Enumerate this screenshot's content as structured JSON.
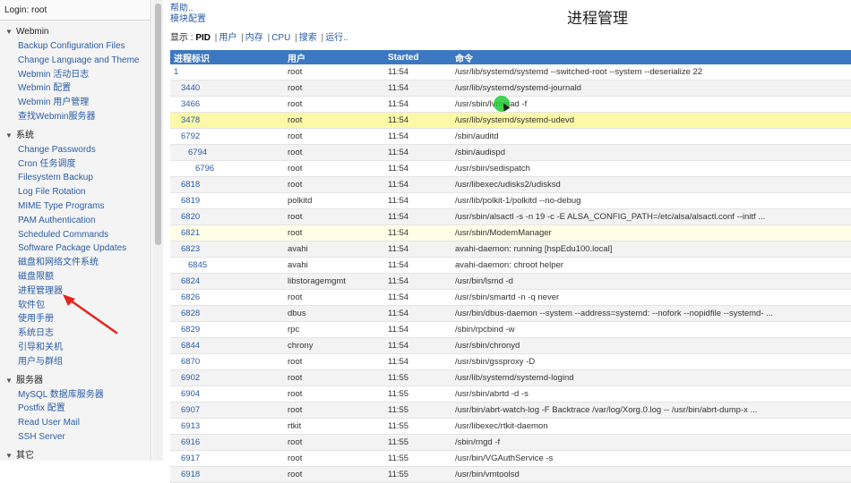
{
  "login": "Login: root",
  "sidebar": {
    "categories": [
      {
        "label": "Webmin",
        "items": [
          "Backup Configuration Files",
          "Change Language and Theme",
          "Webmin 活动日志",
          "Webmin 配置",
          "Webmin 用户管理",
          "查找Webmin服务器"
        ]
      },
      {
        "label": "系统",
        "items": [
          "Change Passwords",
          "Cron 任务调度",
          "Filesystem Backup",
          "Log File Rotation",
          "MIME Type Programs",
          "PAM Authentication",
          "Scheduled Commands",
          "Software Package Updates",
          "磁盘和网络文件系统",
          "磁盘限额",
          "进程管理器",
          "软件包",
          "使用手册",
          "系统日志",
          "引导和关机",
          "用户与群组"
        ]
      },
      {
        "label": "服务器",
        "items": [
          "MySQL 数据库服务器",
          "Postfix 配置",
          "Read User Mail",
          "SSH Server"
        ]
      },
      {
        "label": "其它",
        "items": []
      }
    ]
  },
  "top_links": [
    "帮助..",
    "模块配置"
  ],
  "title": "进程管理",
  "display_bar": {
    "prefix": "显示 :",
    "active": "PID",
    "links": [
      "用户",
      "内存",
      "CPU",
      "搜索",
      "运行.."
    ]
  },
  "table": {
    "headers": [
      "进程标识",
      "用户",
      "Started",
      "命令"
    ],
    "rows": [
      {
        "pid": "1",
        "indent": 0,
        "user": "root",
        "started": "11:54",
        "cmd": "/usr/lib/systemd/systemd --switched-root --system --deserialize 22"
      },
      {
        "pid": "3440",
        "indent": 1,
        "user": "root",
        "started": "11:54",
        "cmd": "/usr/lib/systemd/systemd-journald"
      },
      {
        "pid": "3466",
        "indent": 1,
        "user": "root",
        "started": "11:54",
        "cmd": "/usr/sbin/lvmetad -f"
      },
      {
        "pid": "3478",
        "indent": 1,
        "user": "root",
        "started": "11:54",
        "cmd": "/usr/lib/systemd/systemd-udevd"
      },
      {
        "pid": "6792",
        "indent": 1,
        "user": "root",
        "started": "11:54",
        "cmd": "/sbin/auditd"
      },
      {
        "pid": "6794",
        "indent": 2,
        "user": "root",
        "started": "11:54",
        "cmd": "/sbin/audispd"
      },
      {
        "pid": "6796",
        "indent": 3,
        "user": "root",
        "started": "11:54",
        "cmd": "/usr/sbin/sedispatch"
      },
      {
        "pid": "6818",
        "indent": 1,
        "user": "root",
        "started": "11:54",
        "cmd": "/usr/libexec/udisks2/udisksd"
      },
      {
        "pid": "6819",
        "indent": 1,
        "user": "polkitd",
        "started": "11:54",
        "cmd": "/usr/lib/polkit-1/polkitd --no-debug"
      },
      {
        "pid": "6820",
        "indent": 1,
        "user": "root",
        "started": "11:54",
        "cmd": "/usr/sbin/alsactl -s -n 19 -c -E ALSA_CONFIG_PATH=/etc/alsa/alsactl.conf --initf ..."
      },
      {
        "pid": "6821",
        "indent": 1,
        "user": "root",
        "started": "11:54",
        "cmd": "/usr/sbin/ModemManager"
      },
      {
        "pid": "6823",
        "indent": 1,
        "user": "avahi",
        "started": "11:54",
        "cmd": "avahi-daemon: running [hspEdu100.local]"
      },
      {
        "pid": "6845",
        "indent": 2,
        "user": "avahi",
        "started": "11:54",
        "cmd": "avahi-daemon: chroot helper"
      },
      {
        "pid": "6824",
        "indent": 1,
        "user": "libstoragemgmt",
        "started": "11:54",
        "cmd": "/usr/bin/lsmd -d"
      },
      {
        "pid": "6826",
        "indent": 1,
        "user": "root",
        "started": "11:54",
        "cmd": "/usr/sbin/smartd -n -q never"
      },
      {
        "pid": "6828",
        "indent": 1,
        "user": "dbus",
        "started": "11:54",
        "cmd": "/usr/bin/dbus-daemon --system --address=systemd: --nofork --nopidfile --systemd- ..."
      },
      {
        "pid": "6829",
        "indent": 1,
        "user": "rpc",
        "started": "11:54",
        "cmd": "/sbin/rpcbind -w"
      },
      {
        "pid": "6844",
        "indent": 1,
        "user": "chrony",
        "started": "11:54",
        "cmd": "/usr/sbin/chronyd"
      },
      {
        "pid": "6870",
        "indent": 1,
        "user": "root",
        "started": "11:54",
        "cmd": "/usr/sbin/gssproxy -D"
      },
      {
        "pid": "6902",
        "indent": 1,
        "user": "root",
        "started": "11:55",
        "cmd": "/usr/lib/systemd/systemd-logind"
      },
      {
        "pid": "6904",
        "indent": 1,
        "user": "root",
        "started": "11:55",
        "cmd": "/usr/sbin/abrtd -d -s"
      },
      {
        "pid": "6907",
        "indent": 1,
        "user": "root",
        "started": "11:55",
        "cmd": "/usr/bin/abrt-watch-log -F Backtrace /var/log/Xorg.0.log -- /usr/bin/abrt-dump-x ..."
      },
      {
        "pid": "6913",
        "indent": 1,
        "user": "rtkit",
        "started": "11:55",
        "cmd": "/usr/libexec/rtkit-daemon"
      },
      {
        "pid": "6916",
        "indent": 1,
        "user": "root",
        "started": "11:55",
        "cmd": "/sbin/rngd -f"
      },
      {
        "pid": "6917",
        "indent": 1,
        "user": "root",
        "started": "11:55",
        "cmd": "/usr/bin/VGAuthService -s"
      },
      {
        "pid": "6918",
        "indent": 1,
        "user": "root",
        "started": "11:55",
        "cmd": "/usr/bin/vmtoolsd"
      }
    ]
  },
  "colors": {
    "header_bg": "#3c78c2",
    "link": "#2a5ca8",
    "row_highlight": "#fbf9a8",
    "annotation_arrow": "#e8231d"
  }
}
